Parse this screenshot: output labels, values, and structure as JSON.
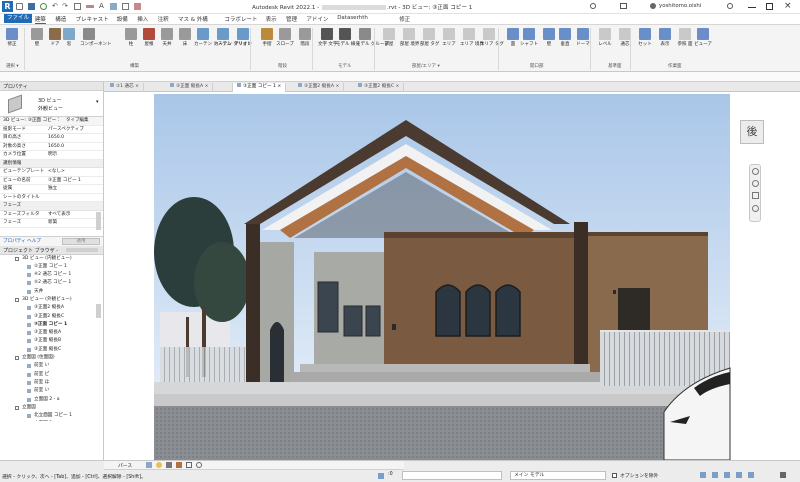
{
  "window": {
    "title": "Autodesk Revit 2022.1 - ",
    "title_doc": ".rvt - 3D ビュー: ③正面 コピー 1",
    "user": "yoshitomo.oishi"
  },
  "menu": [
    "ファイル",
    "建築",
    "構造",
    "プレキャスト",
    "設備",
    "挿入",
    "注釈",
    "マス & 外構",
    "コラボレート",
    "表示",
    "管理",
    "アドイン",
    "Dataserhth",
    "修正"
  ],
  "ribbon": {
    "tools": [
      {
        "label": "修正",
        "color": "#6a8fc8"
      },
      {
        "label": "壁",
        "color": "#9a9a9a"
      },
      {
        "label": "ドア",
        "color": "#8b6b4a"
      },
      {
        "label": "窓",
        "color": "#7fa7c9"
      },
      {
        "label": "コンポーネント",
        "color": "#8a8a8a"
      },
      {
        "label": "柱",
        "color": "#9a9a9a"
      },
      {
        "label": "屋根",
        "color": "#b04a3a"
      },
      {
        "label": "天井",
        "color": "#9a9a9a"
      },
      {
        "label": "床",
        "color": "#9a9a9a"
      },
      {
        "label": "カーテン システム",
        "color": "#6a9ac8"
      },
      {
        "label": "カーテン グリッド",
        "color": "#6a9ac8"
      },
      {
        "label": "マリオン",
        "color": "#6a9ac8"
      },
      {
        "label": "手摺",
        "color": "#b98b3a"
      },
      {
        "label": "スロープ",
        "color": "#9a9a9a"
      },
      {
        "label": "階段",
        "color": "#9a9a9a"
      },
      {
        "label": "文字 文字",
        "color": "#555555"
      },
      {
        "label": "モデル 線分",
        "color": "#555555"
      },
      {
        "label": "モデル グループ",
        "color": "#8a8a8a"
      },
      {
        "label": "部屋",
        "color": "#c9c9c9"
      },
      {
        "label": "部屋 境界",
        "color": "#c9c9c9"
      },
      {
        "label": "部屋 タグ",
        "color": "#c9c9c9"
      },
      {
        "label": "エリア",
        "color": "#c9c9c9"
      },
      {
        "label": "エリア 境界",
        "color": "#c9c9c9"
      },
      {
        "label": "エリア タグ",
        "color": "#c9c9c9"
      },
      {
        "label": "面",
        "color": "#6a8fc8"
      },
      {
        "label": "シャフト",
        "color": "#6a8fc8"
      },
      {
        "label": "壁",
        "color": "#6a8fc8"
      },
      {
        "label": "垂直",
        "color": "#6a8fc8"
      },
      {
        "label": "ドーマ",
        "color": "#6a8fc8"
      },
      {
        "label": "レベル",
        "color": "#c9c9c9"
      },
      {
        "label": "通芯",
        "color": "#c9c9c9"
      },
      {
        "label": "セット",
        "color": "#6a8fc8"
      },
      {
        "label": "表示",
        "color": "#6a8fc8"
      },
      {
        "label": "参照 面",
        "color": "#c9c9c9"
      },
      {
        "label": "ビューア",
        "color": "#6a8fc8"
      }
    ],
    "groups": [
      "選択 ▾",
      "構築",
      "階段",
      "モデル",
      "部屋/エリア ▾",
      "開口部",
      "基準面",
      "作業面"
    ]
  },
  "properties": {
    "header": "プロパティ",
    "type_name": "3D ビュー",
    "type_sub": "外観ビュー",
    "instance_label": "3D ビュー: ③正面 コピー 1",
    "edit_type": "タイプ編集",
    "rows": [
      {
        "k": "投影モード",
        "v": "パースペクティブ"
      },
      {
        "k": "目の高さ",
        "v": "1650.0"
      },
      {
        "k": "対象の高さ",
        "v": "1650.0"
      },
      {
        "k": "カメラ位置",
        "v": "明示"
      }
    ],
    "section_identity": "識別情報",
    "identity_rows": [
      {
        "k": "ビューテンプレート",
        "v": "<なし>"
      },
      {
        "k": "ビューの名前",
        "v": "③正面 コピー 1"
      },
      {
        "k": "従属",
        "v": "独立"
      },
      {
        "k": "シートのタイトル",
        "v": ""
      }
    ],
    "section_phase": "フェーズ",
    "phase_rows": [
      {
        "k": "フェーズフィルタ",
        "v": "すべて表示"
      },
      {
        "k": "フェーズ",
        "v": "新築"
      }
    ],
    "help": "プロパティ ヘルプ",
    "apply": "適用"
  },
  "browser": {
    "header": "プロジェクト ブラウザ - ",
    "items": [
      {
        "t": "3D ビュー (内観ビュー)",
        "indent": 1,
        "exp": "−"
      },
      {
        "t": "①正面 コピー 1",
        "indent": 3,
        "exp": ""
      },
      {
        "t": "④2 通芯 コピー 1",
        "indent": 3,
        "exp": ""
      },
      {
        "t": "⑤2 通芯 コピー 1",
        "indent": 3,
        "exp": ""
      },
      {
        "t": "天井",
        "indent": 3,
        "exp": ""
      },
      {
        "t": "3D ビュー (外観ビュー)",
        "indent": 1,
        "exp": "−"
      },
      {
        "t": "③正面2 縦長A",
        "indent": 3,
        "exp": ""
      },
      {
        "t": "③正面2 縦長C",
        "indent": 3,
        "exp": ""
      },
      {
        "t": "③正面 コピー 1",
        "indent": 3,
        "exp": "",
        "bold": true
      },
      {
        "t": "③正面 縦長A",
        "indent": 3,
        "exp": ""
      },
      {
        "t": "③正面 縦長B",
        "indent": 3,
        "exp": ""
      },
      {
        "t": "③正面 縦長C",
        "indent": 3,
        "exp": ""
      },
      {
        "t": "立面図 (住面図)",
        "indent": 1,
        "exp": "−"
      },
      {
        "t": "前室 い",
        "indent": 3,
        "exp": ""
      },
      {
        "t": "前室 ピ",
        "indent": 3,
        "exp": ""
      },
      {
        "t": "前室 ほ",
        "indent": 3,
        "exp": ""
      },
      {
        "t": "前室 い",
        "indent": 3,
        "exp": ""
      },
      {
        "t": "立面図 2 - a",
        "indent": 3,
        "exp": ""
      },
      {
        "t": "立面図",
        "indent": 1,
        "exp": "−"
      },
      {
        "t": "北立面図 コピー 1",
        "indent": 3,
        "exp": ""
      },
      {
        "t": "立面図 2 - a",
        "indent": 3,
        "exp": ""
      }
    ]
  },
  "tabs": [
    {
      "label": "①1 通芯"
    },
    {
      "label": "③正面 縦長A"
    },
    {
      "label": "③正面 コピー 1",
      "active": true
    },
    {
      "label": "③正面2 縦長A"
    },
    {
      "label": "③正面2 縦長C"
    }
  ],
  "viewcube": {
    "face": "後"
  },
  "status": {
    "hint": "選択 - クリック、次へ - [Tab]、追加 - [Ctrl]、選択解除 - [Shift]。",
    "zoom": "パース",
    "model": "メイン モデル",
    "exclude": "オプションを除外",
    "coord": ":0"
  }
}
